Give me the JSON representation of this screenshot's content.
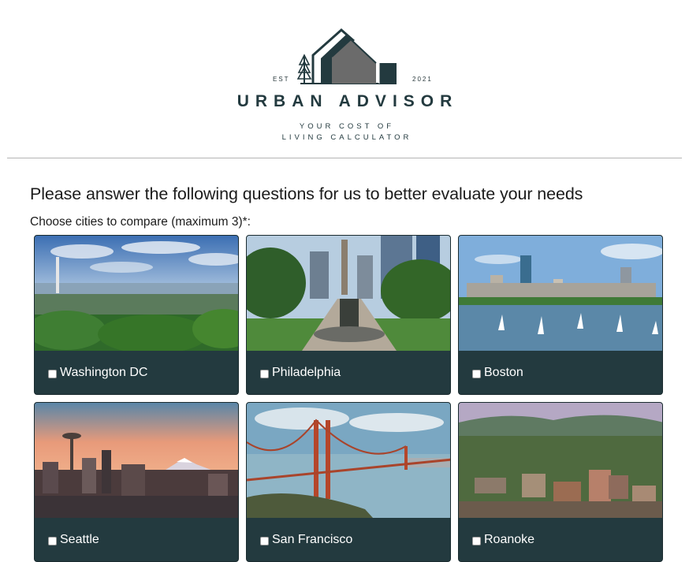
{
  "brand": {
    "est": "EST",
    "year": "2021",
    "name": "URBAN ADVISOR",
    "tagline_line1": "YOUR COST OF",
    "tagline_line2": "LIVING CALCULATOR",
    "colors": {
      "primary": "#233a3f",
      "accent_gray": "#6b6b6b"
    }
  },
  "form": {
    "title": "Please answer the following questions for us to better evaluate your needs",
    "cities_prompt": "Choose cities to compare (maximum 3)*:",
    "cities": [
      {
        "name": "Washington DC",
        "checked": false
      },
      {
        "name": "Philadelphia",
        "checked": false
      },
      {
        "name": "Boston",
        "checked": false
      },
      {
        "name": "Seattle",
        "checked": false
      },
      {
        "name": "San Francisco",
        "checked": false
      },
      {
        "name": "Roanoke",
        "checked": false
      }
    ],
    "card_color": "#233a3f"
  }
}
